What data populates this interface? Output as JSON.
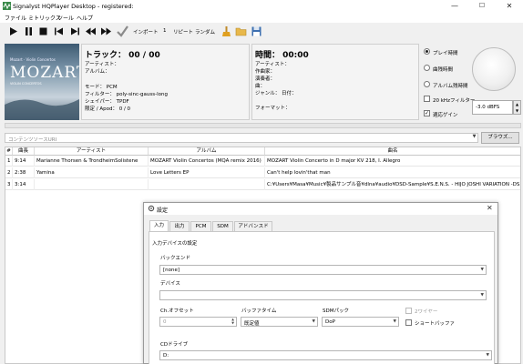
{
  "window": {
    "title": "Signalyst HQPlayer Desktop - registered:",
    "minimize": "—",
    "maximize": "☐",
    "close": "✕"
  },
  "menu": {
    "items": [
      "ファイル",
      "ミトリックス",
      "ツール",
      "ヘルプ"
    ]
  },
  "toolbar": {
    "buttons": [
      "play-icon",
      "pause-icon",
      "stop-icon",
      "previous-icon",
      "next-icon",
      "rewind-icon",
      "fast-forward-icon",
      "check-icon"
    ],
    "import_label": "インポート",
    "repeat_count": "1",
    "repeat_label": "リピート",
    "random_label": "ランダム",
    "tools": [
      "clear-icon",
      "folder-icon",
      "save-icon",
      "transport-icon"
    ]
  },
  "track": {
    "title": "トラック： 00 / 00",
    "artist_label": "アーティスト：",
    "album_label": "アルバム：",
    "mode": "モード： PCM",
    "filter": "フィルター： poly-sinc-gauss-long",
    "shaper": "シェイパー： TPDF",
    "limit": "限定 / Apod： 0 / 0"
  },
  "cover": {
    "top_line": "Mozart · Violin Concertos",
    "big": "MOZART",
    "sub": "VIOLIN CONCERTOS"
  },
  "time": {
    "title": "時間： 00:00",
    "artist_label": "アーティスト：",
    "composer_label": "作曲家：",
    "performer_label": "演奏者：",
    "song_label": "曲：",
    "genre_label": "ジャンル：  日付：",
    "format_label": "フォーマット："
  },
  "options": {
    "radios": [
      "プレイ時間",
      "曲残時間",
      "アルバム残時間"
    ],
    "filter_20k": "20 kHzフィルター",
    "adaptive_gain": "適応ゲイン",
    "volume": "-3.0 dBFS"
  },
  "uri": {
    "placeholder": "コンテンツソースURI",
    "browse": "ブラウズ..."
  },
  "table": {
    "columns": [
      "#",
      "曲長",
      "アーティスト",
      "アルバム",
      "曲名"
    ],
    "rows": [
      [
        "1",
        "9:14",
        "Marianne Thorsen & TrondheimSolistene",
        "MOZART Violin Concertos (MQA remix 2016)",
        "MOZART Violin Concerto in D major KV 218, I. Allegro"
      ],
      [
        "2",
        "2:38",
        "Yamina",
        "Love Letters EP",
        "Can't help lovin'that man"
      ],
      [
        "3",
        "3:14",
        "",
        "",
        "C:¥Users¥Masa¥Music¥製品サンプル音¥dlna¥audio¥DSD-Sample¥S.E.N.S. - HIJO JOSHI VARIATION -DS..."
      ]
    ]
  },
  "dialog": {
    "title": "設定",
    "close": "✕",
    "tabs": [
      "入力",
      "出力",
      "PCM",
      "SDM",
      "アドバンスド"
    ],
    "section": "入力デバイスの設定",
    "backend_label": "バックエンド",
    "backend_value": "[none]",
    "device_label": "デバイス",
    "device_value": "",
    "ch_offset_label": "Ch.オフセット",
    "ch_offset_value": "0",
    "buffer_label": "バッファタイム",
    "buffer_value": "既定値",
    "sdm_pack_label": "SDMパック",
    "sdm_pack_value": "DoP",
    "two_wire_label": "2ワイヤー",
    "short_buffer_label": "ショートバッファ",
    "cd_drive_label": "CDドライブ",
    "cd_drive_value": "D:"
  }
}
